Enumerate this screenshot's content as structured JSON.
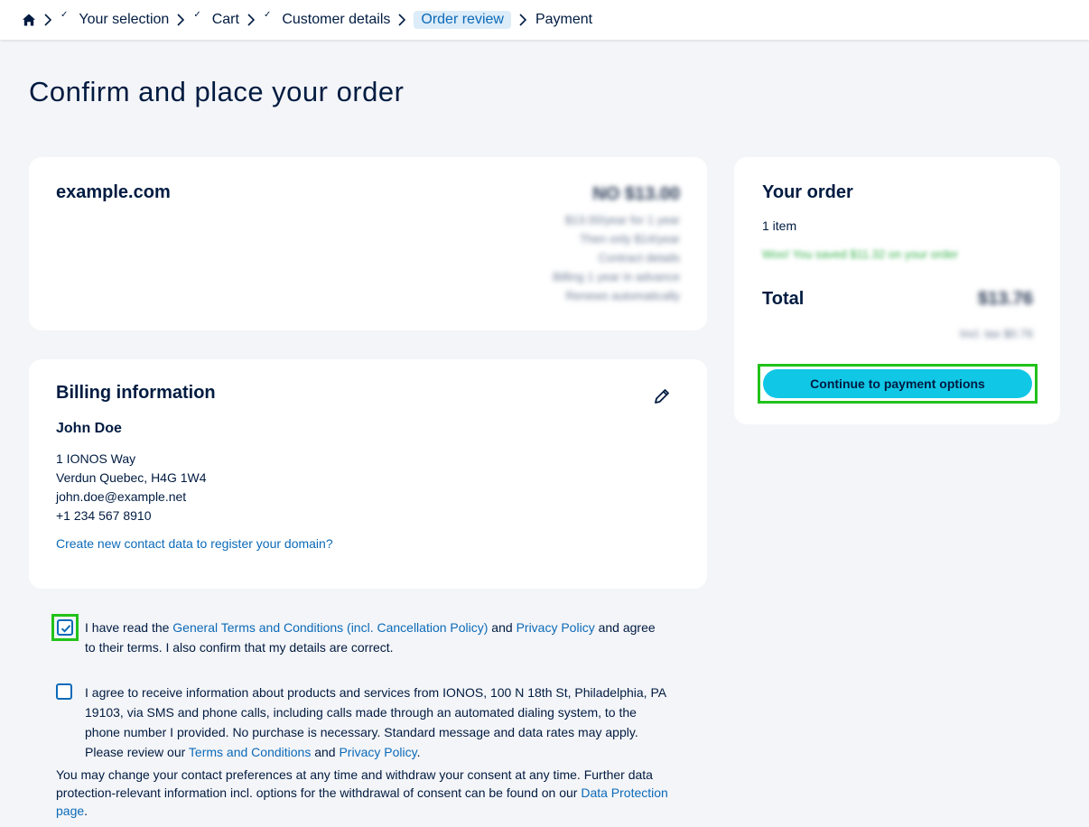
{
  "breadcrumb": {
    "home_icon": "home-icon",
    "items": [
      {
        "label": "Your selection",
        "done": true
      },
      {
        "label": "Cart",
        "done": true
      },
      {
        "label": "Customer details",
        "done": false
      },
      {
        "label": "Order review",
        "active": true
      },
      {
        "label": "Payment",
        "done": false
      }
    ]
  },
  "page": {
    "title": "Confirm and place your order"
  },
  "product": {
    "name": "example.com",
    "blurred_price": "NO $13.00",
    "blurred_lines": [
      "$13.00/year for 1 year",
      "Then only $14/year",
      "Contract details",
      "Billing 1 year in advance",
      "Renews automatically"
    ]
  },
  "billing": {
    "title": "Billing information",
    "name": "John Doe",
    "address_line1": "1 IONOS Way",
    "address_line2": "Verdun Quebec, H4G 1W4",
    "email": "john.doe@example.net",
    "phone": "+1 234 567 8910",
    "contact_link": "Create new contact data to register your domain?"
  },
  "order": {
    "title": "Your order",
    "item_count": "1 item",
    "savings_blurred": "Woo! You saved $11.32 on your order",
    "total_label": "Total",
    "total_blurred": "$13.76",
    "tax_blurred": "Incl. tax $0.76",
    "cta_label": "Continue to payment options"
  },
  "consent": {
    "terms_checked": true,
    "terms_prefix": "I have read the ",
    "terms_link": "General Terms and Conditions (incl. Cancellation Policy)",
    "terms_and": " and ",
    "privacy_link": "Privacy Policy",
    "terms_suffix": " and agree to their terms. I also confirm that my details are correct.",
    "marketing_checked": false,
    "marketing_text": "I agree to receive information about products and services from IONOS, 100 N 18th St, Philadelphia, PA 19103, via SMS and phone calls, including calls made through an automated dialing system, to the phone number I provided. No purchase is necessary. Standard message and data rates may apply. Please review our ",
    "marketing_terms_link": "Terms and Conditions",
    "marketing_and": " and ",
    "marketing_privacy_link": "Privacy Policy",
    "marketing_end": ".",
    "footer_text": "You may change your contact preferences at any time and withdraw your consent at any time. Further data protection-relevant information incl. options for the withdrawal of consent can be found on our ",
    "data_protection_link": "Data Protection page",
    "footer_end": "."
  },
  "colors": {
    "accent": "#11c7e6",
    "link": "#0b6ab8",
    "highlight": "#22c21a",
    "text": "#001b41"
  }
}
